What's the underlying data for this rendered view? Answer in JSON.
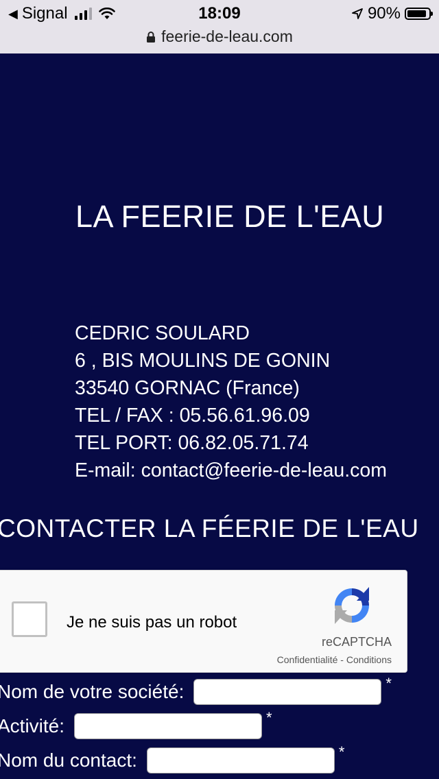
{
  "status_bar": {
    "back_app": "Signal",
    "time": "18:09",
    "battery": "90%",
    "battery_level": 0.9,
    "signal_bars": 3
  },
  "url_bar": {
    "domain": "feerie-de-leau.com"
  },
  "page": {
    "title": "LA FEERIE DE L'EAU",
    "address_lines": [
      "CEDRIC SOULARD",
      "6 , BIS MOULINS DE GONIN",
      "33540 GORNAC (France)",
      "TEL / FAX : 05.56.61.96.09",
      "TEL PORT: 06.82.05.71.74",
      "E-mail: contact@feerie-de-leau.com"
    ],
    "contact_heading": "CONTACTER LA FÉERIE DE L'EAU"
  },
  "recaptcha": {
    "label": "Je ne suis pas un robot",
    "brand": "reCAPTCHA",
    "privacy_link": "Confidentialité",
    "separator": "-",
    "terms_link": "Conditions"
  },
  "form": {
    "fields": [
      {
        "label": "Nom de votre société:",
        "value": "",
        "required_mark": "*"
      },
      {
        "label": "Activité:",
        "value": "",
        "required_mark": "*"
      },
      {
        "label": "Nom du contact:",
        "value": "",
        "required_mark": "*"
      }
    ]
  },
  "colors": {
    "page_background": "#070a45",
    "text": "#ffffff",
    "status_bar_background": "#e6e3ea"
  }
}
